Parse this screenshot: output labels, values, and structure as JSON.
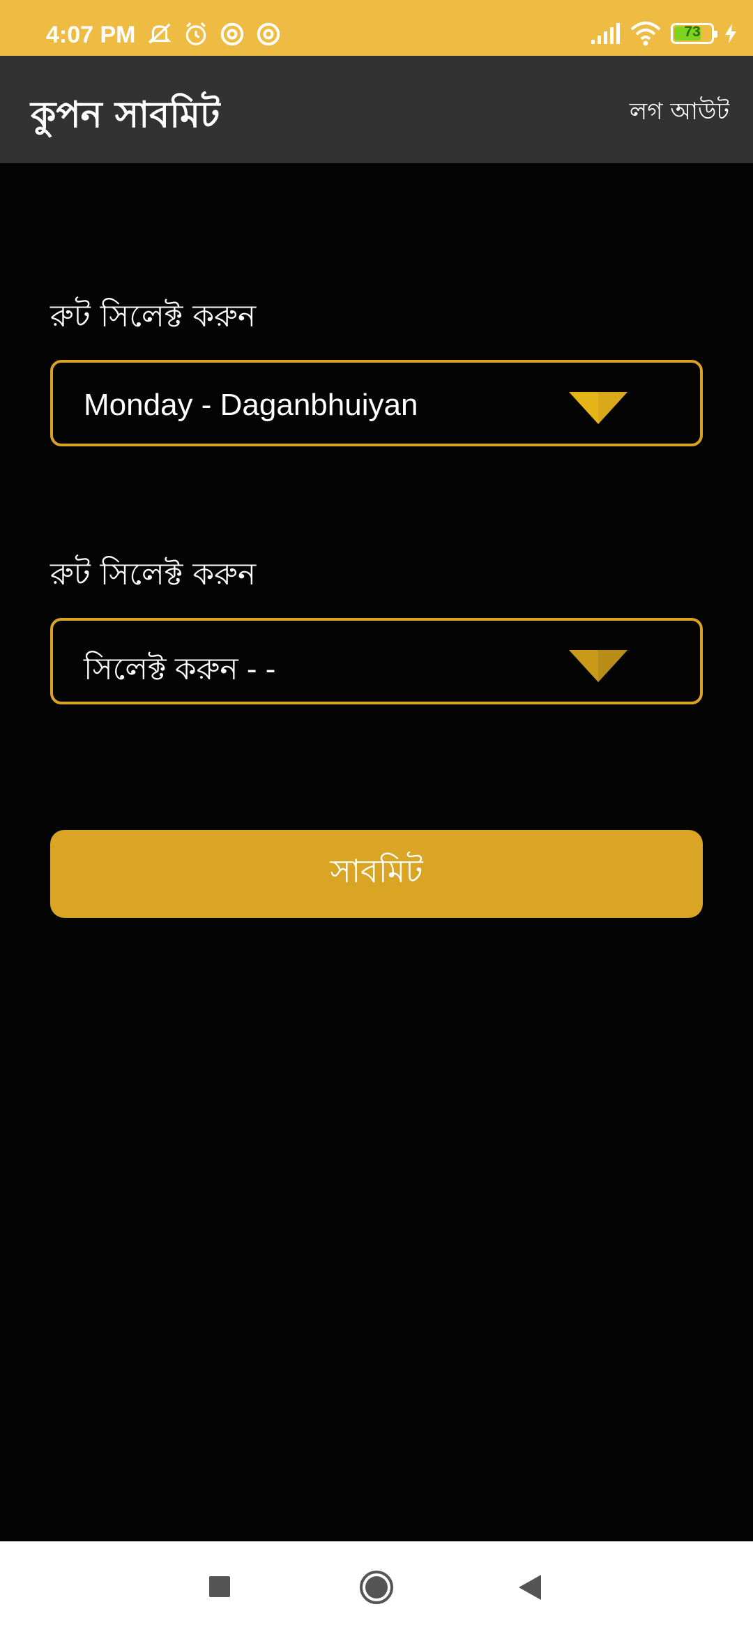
{
  "status_bar": {
    "time": "4:07 PM",
    "battery_level": 73,
    "battery_label": "73",
    "icons_left": [
      "muted-bell-icon",
      "alarm-icon",
      "at-sign-icon",
      "at-sign-icon"
    ],
    "icons_right": [
      "cellular-signal-icon",
      "wifi-icon",
      "battery-icon",
      "charging-bolt-icon"
    ]
  },
  "app_bar": {
    "title": "কুপন সাবমিট",
    "logout_label": "লগ আউট"
  },
  "form": {
    "field1": {
      "label": "রুট সিলেক্ট করুন",
      "value": "Monday - Daganbhuiyan"
    },
    "field2": {
      "label": "রুট সিলেক্ট করুন",
      "placeholder": "সিলেক্ট করুন - -"
    },
    "submit_label": "সাবমিট"
  },
  "nav_bar": {
    "buttons": [
      "recent-apps-icon",
      "home-icon",
      "back-icon"
    ]
  },
  "colors": {
    "status_bar": "#eebb43",
    "app_bar": "#323232",
    "accent": "#daa324",
    "background": "#040404"
  }
}
